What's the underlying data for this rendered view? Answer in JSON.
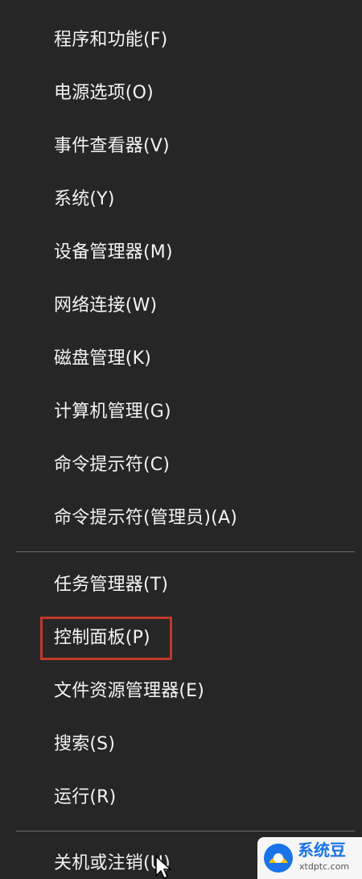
{
  "menu": {
    "items_top": [
      {
        "label": "程序和功能(F)"
      },
      {
        "label": "电源选项(O)"
      },
      {
        "label": "事件查看器(V)"
      },
      {
        "label": "系统(Y)"
      },
      {
        "label": "设备管理器(M)"
      },
      {
        "label": "网络连接(W)"
      },
      {
        "label": "磁盘管理(K)"
      },
      {
        "label": "计算机管理(G)"
      },
      {
        "label": "命令提示符(C)"
      },
      {
        "label": "命令提示符(管理员)(A)"
      }
    ],
    "items_middle": [
      {
        "label": "任务管理器(T)"
      },
      {
        "label": "控制面板(P)"
      },
      {
        "label": "文件资源管理器(E)"
      },
      {
        "label": "搜索(S)"
      },
      {
        "label": "运行(R)"
      }
    ],
    "items_bottom": [
      {
        "label": "关机或注销(U)"
      }
    ]
  },
  "highlight_color": "#c0392b",
  "watermark": {
    "title": "系统豆",
    "site": "xtdptc.com",
    "icon": "watermark-logo-icon"
  }
}
